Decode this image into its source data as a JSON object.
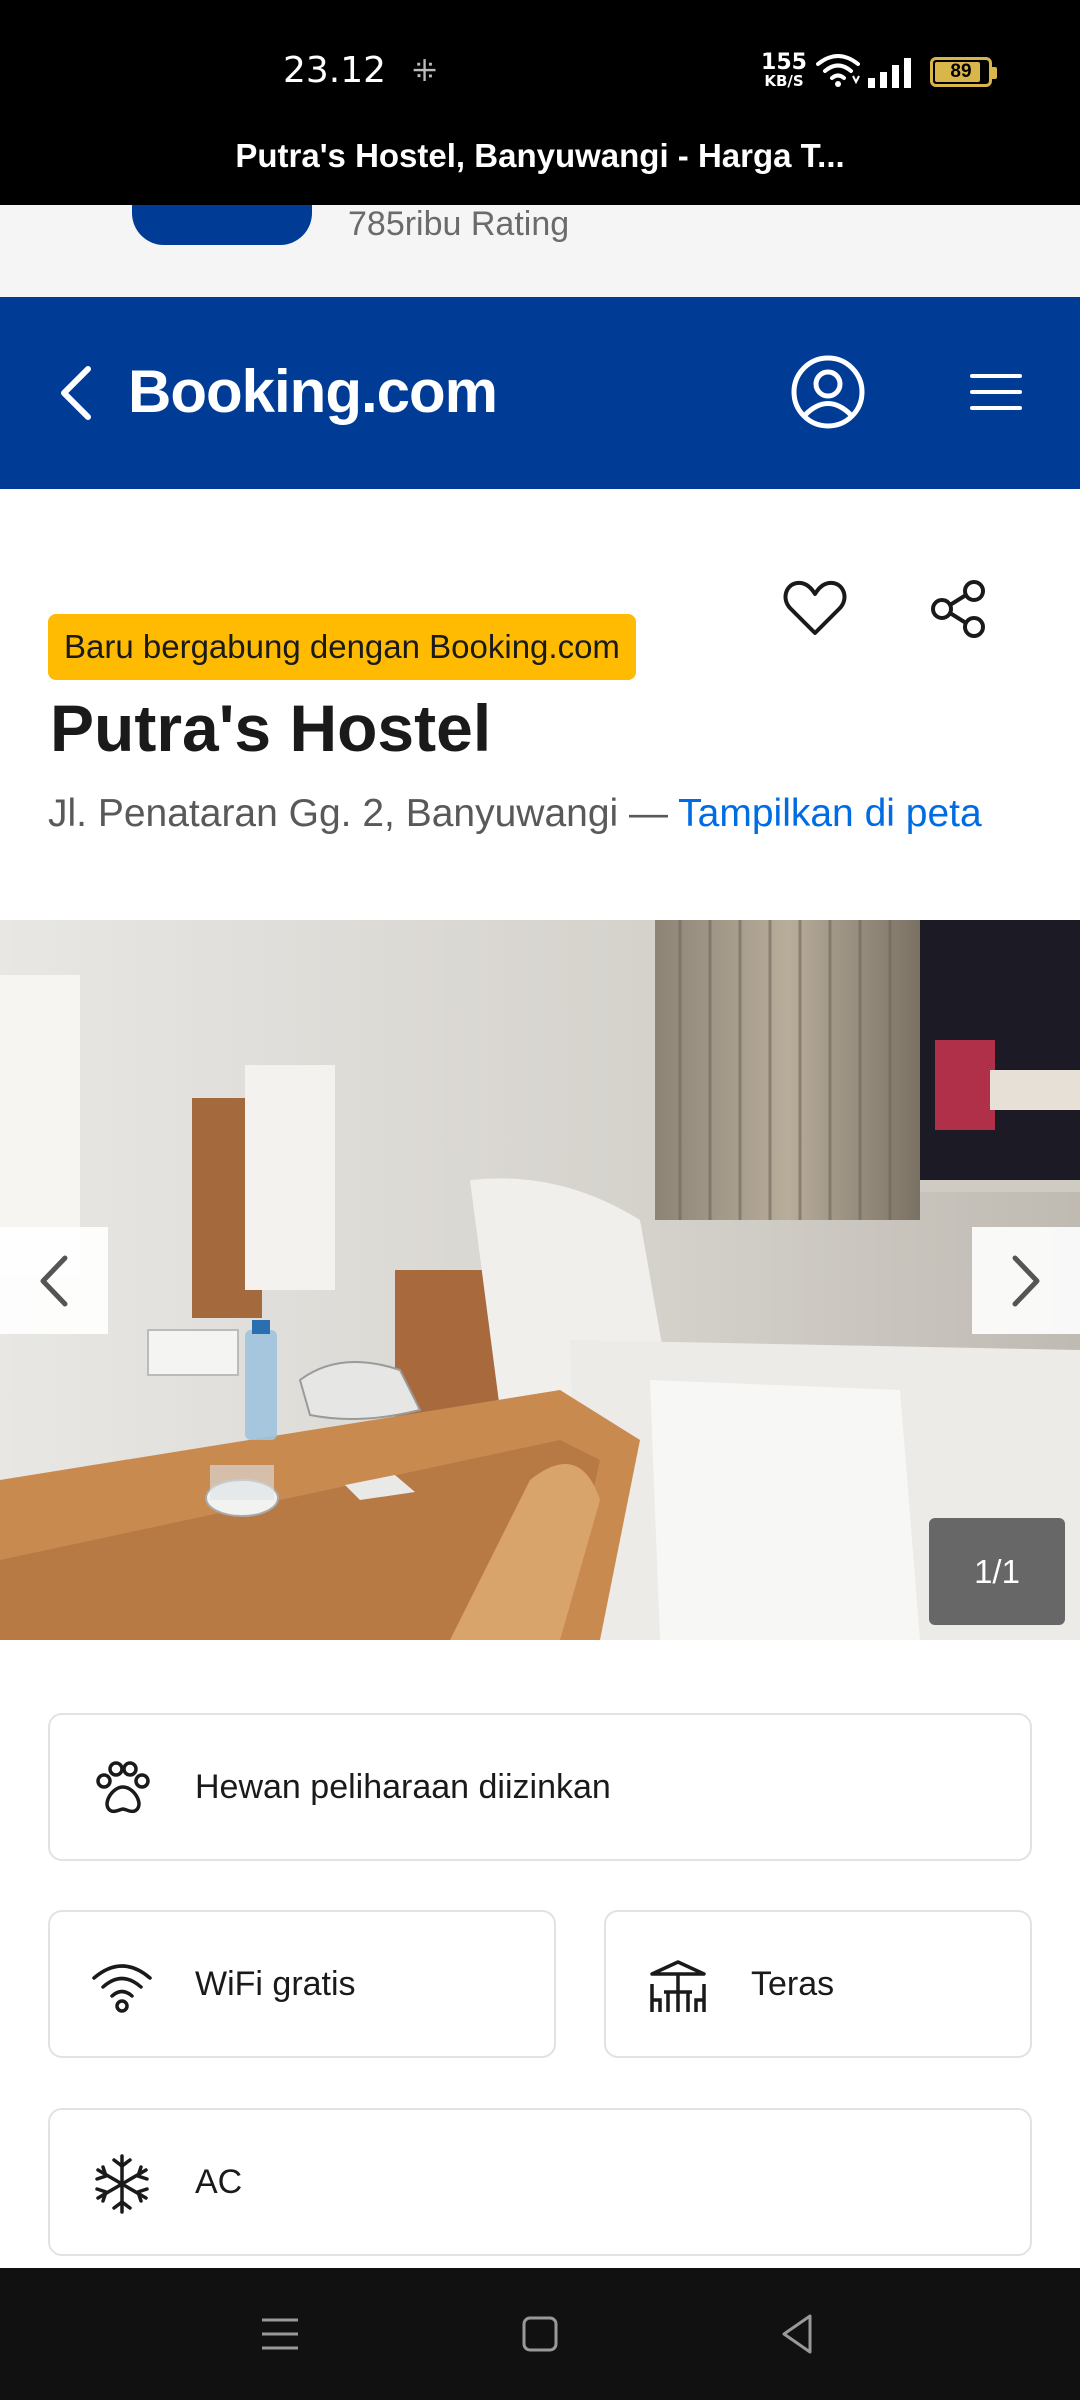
{
  "status_bar": {
    "time": "23.12",
    "net_speed_value": "155",
    "net_speed_unit": "KB/S",
    "battery_level": "89",
    "battery_color": "#d8b64a"
  },
  "browser": {
    "page_title": "Putra's Hostel, Banyuwangi - Harga T..."
  },
  "app_banner": {
    "rating_text": "785ribu Rating"
  },
  "header": {
    "brand": "Booking.com",
    "brand_color": "#003b95",
    "icons": [
      "chevron-left-icon",
      "account-icon",
      "menu-icon"
    ]
  },
  "property": {
    "badge": "Baru bergabung dengan Booking.com",
    "badge_color": "#febb02",
    "name": "Putra's Hostel",
    "address": "Jl. Penataran Gg. 2, Banyuwangi",
    "address_separator": " — ",
    "map_link": "Tampilkan di peta",
    "link_color": "#006ce4",
    "icons": [
      "heart-icon",
      "share-icon"
    ]
  },
  "gallery": {
    "counter": "1/1",
    "icons": [
      "chevron-left-icon",
      "chevron-right-icon"
    ]
  },
  "facilities": [
    {
      "label": "Hewan peliharaan diizinkan",
      "icon": "paw-icon"
    },
    {
      "label": "WiFi gratis",
      "icon": "wifi-icon"
    },
    {
      "label": "Teras",
      "icon": "terrace-icon"
    },
    {
      "label": "AC",
      "icon": "snowflake-icon"
    }
  ],
  "nav_bar": {
    "icons": [
      "recent-apps-icon",
      "home-icon",
      "back-icon"
    ]
  }
}
